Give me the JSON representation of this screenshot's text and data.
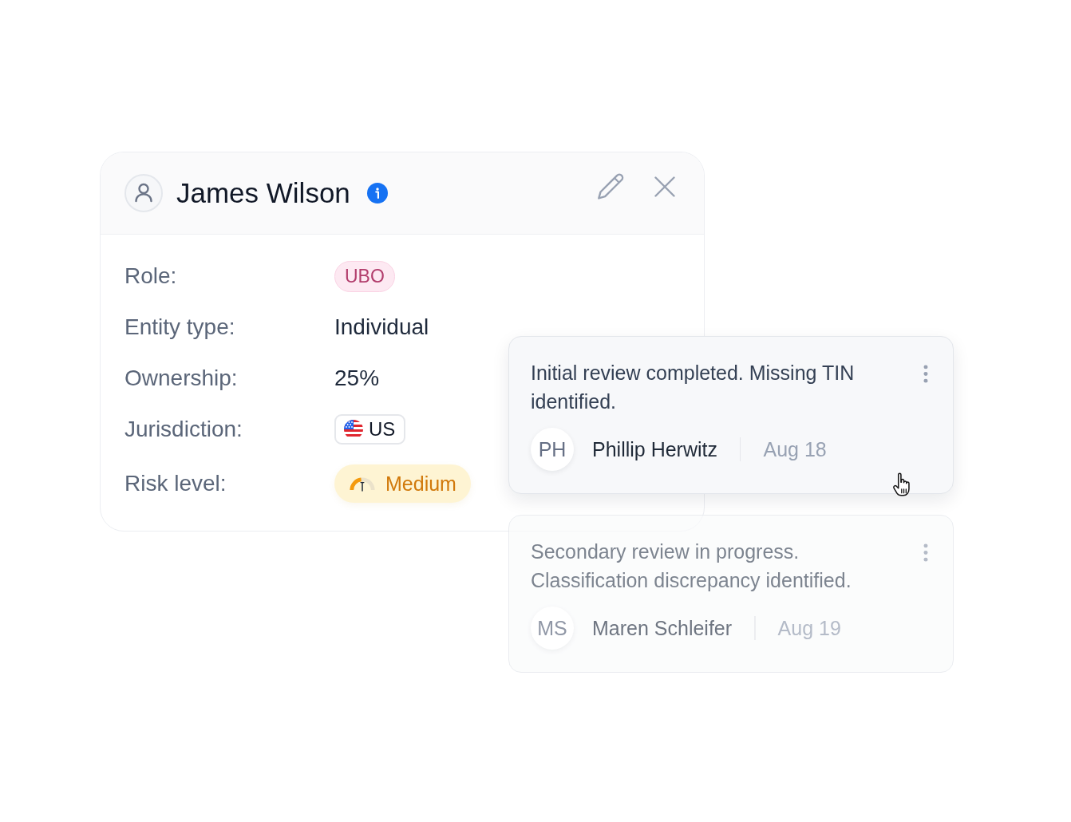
{
  "profile": {
    "name": "James Wilson",
    "fields": [
      {
        "label": "Role:",
        "kind": "tag",
        "value": "UBO"
      },
      {
        "label": "Entity type:",
        "kind": "text",
        "value": "Individual"
      },
      {
        "label": "Ownership:",
        "kind": "text",
        "value": "25%"
      },
      {
        "label": "Jurisdiction:",
        "kind": "country",
        "value": "US"
      },
      {
        "label": "Risk level:",
        "kind": "risk",
        "value": "Medium"
      }
    ]
  },
  "comments": [
    {
      "text": "Initial review completed. Missing TIN identified.",
      "initials": "PH",
      "author": "Phillip Herwitz",
      "date": "Aug 18",
      "highlighted": true
    },
    {
      "text": "Secondary review in progress. Classification discrepancy identified.",
      "initials": "MS",
      "author": "Maren Schleifer",
      "date": "Aug 19",
      "highlighted": false
    }
  ]
}
